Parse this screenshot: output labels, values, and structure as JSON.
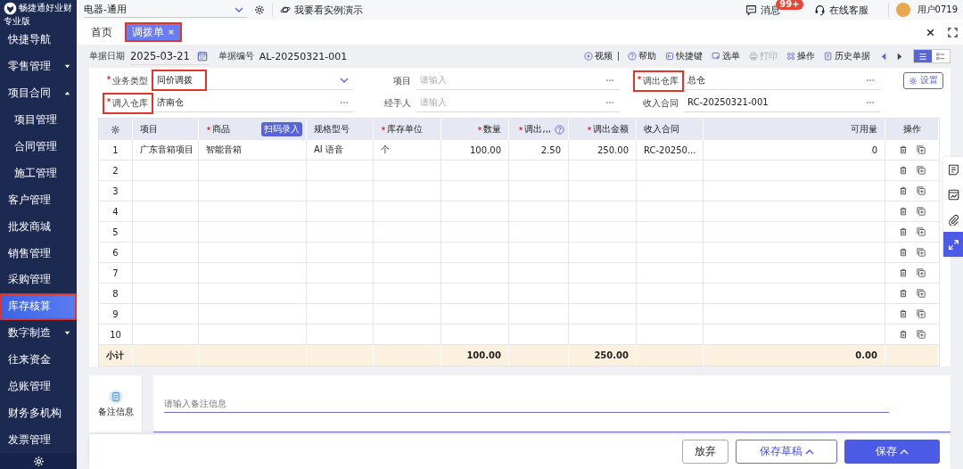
{
  "sidebar": {
    "brand": "畅捷通好业财",
    "edition": "专业版",
    "items": [
      {
        "label": "快捷导航",
        "kind": "link",
        "selected": false,
        "highlighted": false
      },
      {
        "label": "零售管理",
        "kind": "group",
        "expanded": false,
        "selected": false,
        "highlighted": false
      },
      {
        "label": "项目合同",
        "kind": "group",
        "expanded": true,
        "selected": false,
        "highlighted": false,
        "children": [
          {
            "label": "项目管理",
            "selected": false
          },
          {
            "label": "合同管理",
            "selected": false
          },
          {
            "label": "施工管理",
            "selected": false
          }
        ]
      },
      {
        "label": "客户管理",
        "kind": "link",
        "selected": false,
        "highlighted": false
      },
      {
        "label": "批发商城",
        "kind": "link",
        "selected": false,
        "highlighted": false
      },
      {
        "label": "销售管理",
        "kind": "link",
        "selected": false,
        "highlighted": false
      },
      {
        "label": "采购管理",
        "kind": "link",
        "selected": false,
        "highlighted": false
      },
      {
        "label": "库存核算",
        "kind": "link",
        "selected": true,
        "highlighted": true
      },
      {
        "label": "数字制造",
        "kind": "group",
        "expanded": false,
        "selected": false,
        "highlighted": false
      },
      {
        "label": "往来资金",
        "kind": "link",
        "selected": false,
        "highlighted": false
      },
      {
        "label": "总账管理",
        "kind": "link",
        "selected": false,
        "highlighted": false
      },
      {
        "label": "财务多机构",
        "kind": "link",
        "selected": false,
        "highlighted": false
      },
      {
        "label": "发票管理",
        "kind": "link",
        "selected": false,
        "highlighted": false
      }
    ]
  },
  "topbar": {
    "company": "电器-通用",
    "demo_link": "我要看实例演示",
    "messages": {
      "label": "消息",
      "badge": "99+"
    },
    "support": "在线客服",
    "user": "用户0719"
  },
  "tabs": [
    {
      "label": "首页",
      "selected": false,
      "closable": false,
      "highlighted": false
    },
    {
      "label": "调拨单",
      "selected": true,
      "closable": true,
      "highlighted": true
    }
  ],
  "doc_header": {
    "date_label": "单据日期",
    "date": "2025-03-21",
    "number_label": "单据编号",
    "number": "AL-20250321-001"
  },
  "toolbar": [
    {
      "kind": "button",
      "label": "视频",
      "disabled": false
    },
    {
      "kind": "divider"
    },
    {
      "kind": "button",
      "label": "帮助",
      "disabled": false
    },
    {
      "kind": "button",
      "label": "快捷键",
      "disabled": false
    },
    {
      "kind": "button",
      "label": "选单",
      "disabled": false
    },
    {
      "kind": "button",
      "label": "打印",
      "disabled": true
    },
    {
      "kind": "button",
      "label": "操作",
      "disabled": false
    },
    {
      "kind": "button",
      "label": "历史单据",
      "disabled": false
    }
  ],
  "view_toggle": [
    {
      "selected": true
    },
    {
      "selected": false
    }
  ],
  "form": {
    "fields": [
      {
        "label": "业务类型",
        "required": true,
        "value": "同价调拨",
        "kind": "select",
        "label_highlighted": false,
        "value_highlighted": true
      },
      {
        "label": "项目",
        "required": false,
        "placeholder": "请输入",
        "kind": "lookup",
        "label_highlighted": false,
        "value_highlighted": false
      },
      {
        "label": "调出仓库",
        "required": true,
        "value": "总仓",
        "kind": "lookup",
        "label_highlighted": true,
        "value_highlighted": false
      },
      {
        "label": "调入仓库",
        "required": true,
        "value": "济南仓",
        "kind": "lookup",
        "label_highlighted": true,
        "value_highlighted": false
      },
      {
        "label": "经手人",
        "required": false,
        "placeholder": "请输入",
        "kind": "lookup",
        "label_highlighted": false,
        "value_highlighted": false
      },
      {
        "label": "收入合同",
        "required": false,
        "value": "RC-20250321-001",
        "kind": "lookup",
        "label_highlighted": false,
        "value_highlighted": false
      }
    ],
    "settings_button": "设置"
  },
  "table": {
    "columns": [
      {
        "kind": "index"
      },
      {
        "kind": "text",
        "label": "项目",
        "required": false
      },
      {
        "kind": "text",
        "label": "商品",
        "required": true,
        "badge": "扫码录入"
      },
      {
        "kind": "text",
        "label": "规格型号",
        "required": false
      },
      {
        "kind": "text",
        "label": "库存单位",
        "required": true
      },
      {
        "kind": "number",
        "label": "数量",
        "required": true
      },
      {
        "kind": "number",
        "label": "调出,,,",
        "required": true,
        "help": true
      },
      {
        "kind": "number",
        "label": "调出金额",
        "required": true
      },
      {
        "kind": "text",
        "label": "收入合同",
        "required": false
      },
      {
        "kind": "number",
        "label": "可用量",
        "required": false
      },
      {
        "kind": "actions",
        "label": "操作",
        "required": false
      }
    ],
    "rows": [
      {
        "cells": [
          "1",
          "广东音箱项目",
          "智能音箱",
          "AI 语音",
          "个",
          "100.00",
          "2.50",
          "250.00",
          "RC-20250...",
          "0"
        ]
      },
      {
        "cells": [
          "2"
        ]
      },
      {
        "cells": [
          "3"
        ]
      },
      {
        "cells": [
          "4"
        ]
      },
      {
        "cells": [
          "5"
        ]
      },
      {
        "cells": [
          "6"
        ]
      },
      {
        "cells": [
          "7"
        ]
      },
      {
        "cells": [
          "8"
        ]
      },
      {
        "cells": [
          "9"
        ]
      },
      {
        "cells": [
          "10"
        ]
      }
    ],
    "subtotal": {
      "cells": [
        "小计",
        null,
        null,
        null,
        null,
        "100.00",
        null,
        "250.00",
        null,
        "0.00"
      ]
    }
  },
  "notes": {
    "label": "备注信息",
    "placeholder": "请输入备注信息"
  },
  "footer_buttons": [
    {
      "label": "放弃",
      "kind": "default",
      "menu": false
    },
    {
      "label": "保存草稿",
      "kind": "outline",
      "menu": true
    },
    {
      "label": "保存",
      "kind": "primary",
      "menu": true
    }
  ],
  "side_tools": [
    {
      "active": false
    },
    {
      "active": false
    },
    {
      "active": false
    },
    {
      "active": true
    }
  ]
}
